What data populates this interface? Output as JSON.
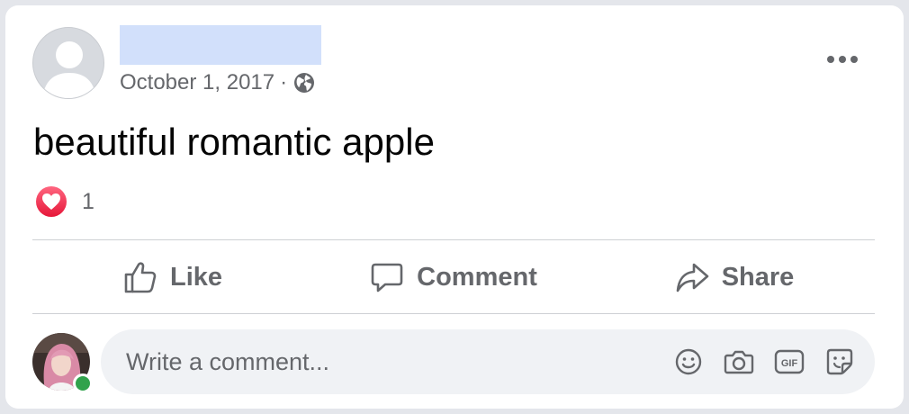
{
  "post": {
    "date": "October 1, 2017",
    "separator": "·",
    "privacy_icon": "globe-icon",
    "text": "beautiful romantic apple",
    "reactions": {
      "icon": "love-reaction-icon",
      "count": "1",
      "color": "#f33e58"
    }
  },
  "actions": {
    "like": "Like",
    "comment": "Comment",
    "share": "Share"
  },
  "comment_composer": {
    "placeholder": "Write a comment...",
    "tools": [
      "emoji-icon",
      "camera-icon",
      "gif-icon",
      "sticker-icon"
    ],
    "online_status_color": "#31a24c"
  },
  "colors": {
    "secondary_text": "#65676b",
    "primary_text": "#050505",
    "redacted_name_block": "#d2e0fb"
  }
}
